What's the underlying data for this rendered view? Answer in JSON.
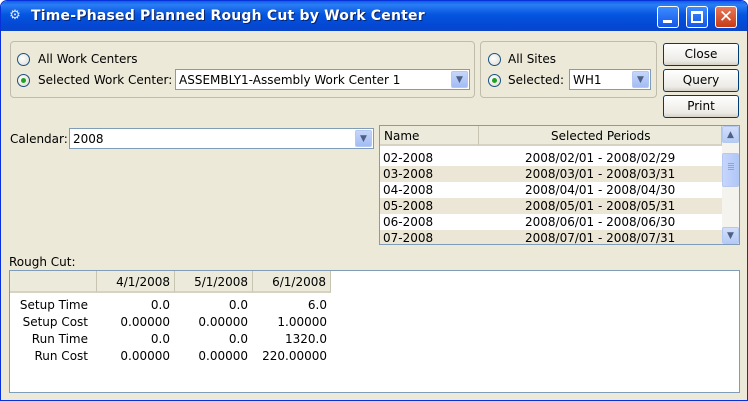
{
  "window": {
    "title": "Time-Phased Planned Rough Cut by Work Center",
    "icon": "app-gears-icon"
  },
  "work_center": {
    "all_label": "All Work Centers",
    "selected_label": "Selected Work Center:",
    "selected_value": "ASSEMBLY1-Assembly Work Center 1",
    "mode": "selected"
  },
  "sites": {
    "all_label": "All Sites",
    "selected_label": "Selected:",
    "selected_value": "WH1",
    "mode": "selected"
  },
  "buttons": {
    "close": "Close",
    "query": "Query",
    "print": "Print"
  },
  "calendar": {
    "label": "Calendar:",
    "value": "2008"
  },
  "periods": {
    "columns": [
      "Name",
      "Selected Periods"
    ],
    "rows": [
      {
        "name": "02-2008",
        "range": "2008/02/01 - 2008/02/29"
      },
      {
        "name": "03-2008",
        "range": "2008/03/01 - 2008/03/31"
      },
      {
        "name": "04-2008",
        "range": "2008/04/01 - 2008/04/30"
      },
      {
        "name": "05-2008",
        "range": "2008/05/01 - 2008/05/31"
      },
      {
        "name": "06-2008",
        "range": "2008/06/01 - 2008/06/30"
      },
      {
        "name": "07-2008",
        "range": "2008/07/01 - 2008/07/31"
      }
    ]
  },
  "rough_cut": {
    "label": "Rough Cut:",
    "columns": [
      "",
      "4/1/2008",
      "5/1/2008",
      "6/1/2008"
    ],
    "rows": [
      {
        "name": "Setup Time",
        "values": [
          "0.0",
          "0.0",
          "6.0"
        ]
      },
      {
        "name": "Setup Cost",
        "values": [
          "0.00000",
          "0.00000",
          "1.00000"
        ]
      },
      {
        "name": "Run Time",
        "values": [
          "0.0",
          "0.0",
          "1320.0"
        ]
      },
      {
        "name": "Run Cost",
        "values": [
          "0.00000",
          "0.00000",
          "220.00000"
        ]
      }
    ]
  }
}
